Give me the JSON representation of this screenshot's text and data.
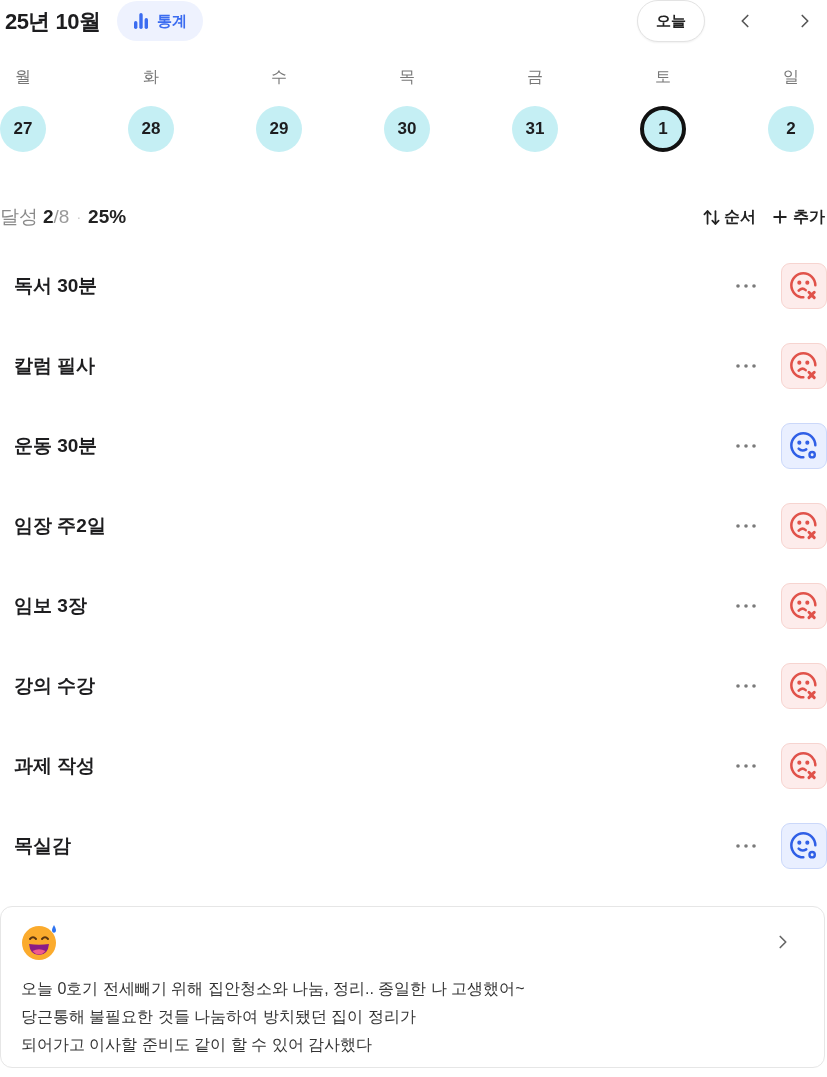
{
  "header": {
    "title": "25년 10월",
    "stats_button": "통계",
    "today_button": "오늘"
  },
  "week": [
    {
      "weekday": "월",
      "day": "27",
      "selected": false
    },
    {
      "weekday": "화",
      "day": "28",
      "selected": false
    },
    {
      "weekday": "수",
      "day": "29",
      "selected": false
    },
    {
      "weekday": "목",
      "day": "30",
      "selected": false
    },
    {
      "weekday": "금",
      "day": "31",
      "selected": false
    },
    {
      "weekday": "토",
      "day": "1",
      "selected": true
    },
    {
      "weekday": "일",
      "day": "2",
      "selected": false
    }
  ],
  "summary": {
    "label": "달성",
    "done": "2",
    "total": "/8",
    "separator": "·",
    "percent": "25%"
  },
  "actions": [
    {
      "kind": "sort",
      "label": "순서"
    },
    {
      "kind": "add",
      "label": "추가"
    }
  ],
  "habits": [
    {
      "name": "독서 30분",
      "achieved": false
    },
    {
      "name": "칼럼 필사",
      "achieved": false
    },
    {
      "name": "운동 30분",
      "achieved": true
    },
    {
      "name": "임장 주2일",
      "achieved": false
    },
    {
      "name": "임보 3장",
      "achieved": false
    },
    {
      "name": "강의 수강",
      "achieved": false
    },
    {
      "name": "과제 작성",
      "achieved": false
    },
    {
      "name": "목실감",
      "achieved": true
    }
  ],
  "diary": {
    "lines": [
      "오늘 0호기 전세빼기 위해 집안청소와 나눔, 정리.. 종일한 나 고생했어~",
      "당근통해 불필요한 것들 나눔하여 방치됐던 집이 정리가",
      "되어가고 이사할 준비도 같이 할 수 있어 감사했다"
    ]
  }
}
